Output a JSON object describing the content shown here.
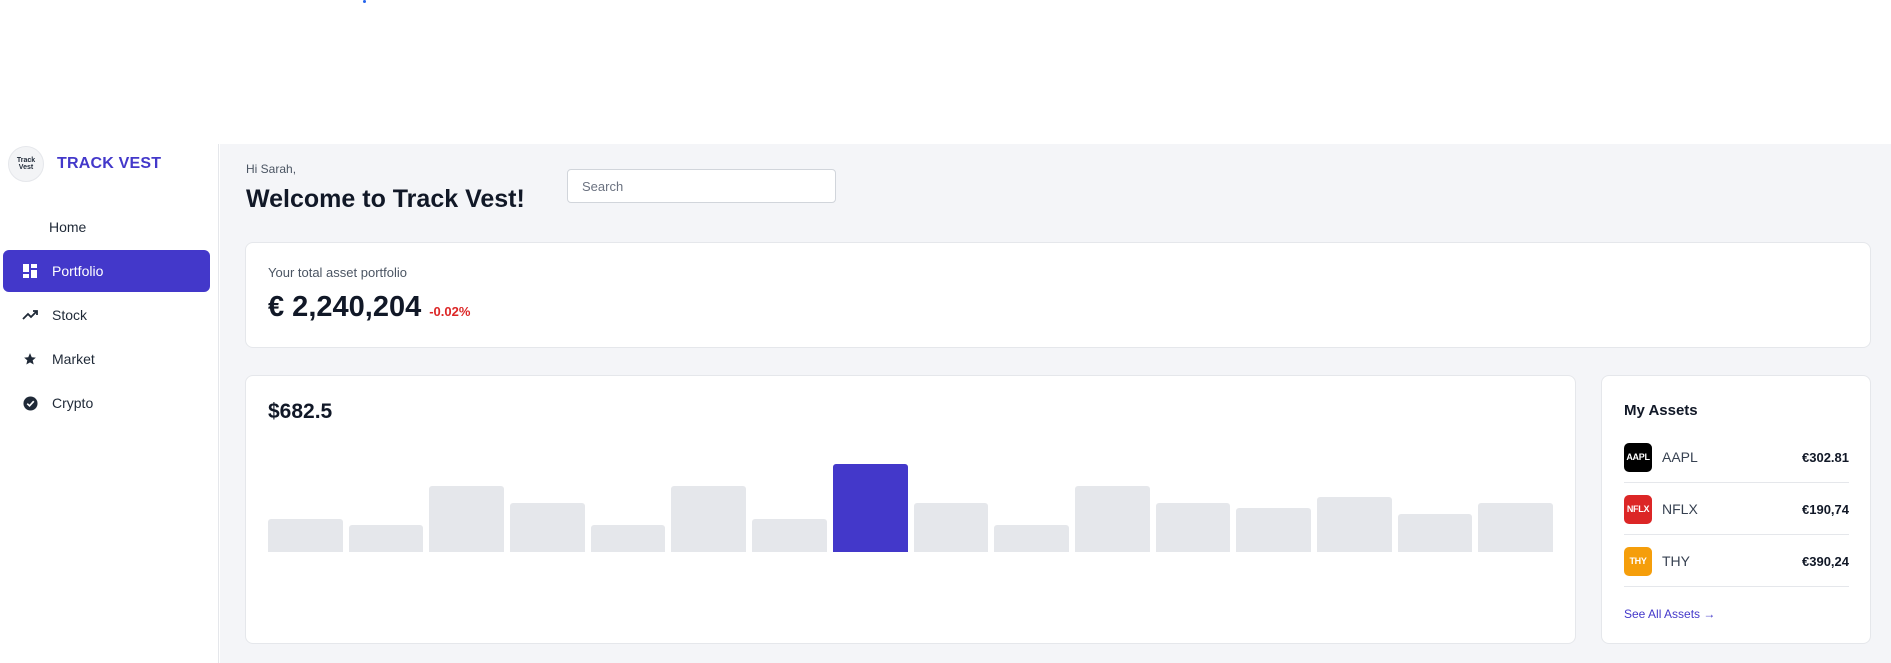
{
  "brand": {
    "logo_text": "Track Vest",
    "name": "TRACK VEST",
    "accent_color": "#4338ca"
  },
  "sidebar": {
    "items": [
      {
        "label": "Home",
        "icon": "none",
        "active": false
      },
      {
        "label": "Portfolio",
        "icon": "dashboard-icon",
        "active": true
      },
      {
        "label": "Stock",
        "icon": "trending-up-icon",
        "active": false
      },
      {
        "label": "Market",
        "icon": "star-icon",
        "active": false
      },
      {
        "label": "Crypto",
        "icon": "check-circle-icon",
        "active": false
      }
    ]
  },
  "header": {
    "greeting": "Hi Sarah,",
    "welcome": "Welcome to Track Vest!",
    "search_placeholder": "Search"
  },
  "total": {
    "label": "Your total asset portfolio",
    "amount": "€ 2,240,204",
    "change": "-0.02%",
    "change_color": "#dc2626"
  },
  "chart_data": {
    "type": "bar",
    "title": "$682.5",
    "values": [
      30,
      25,
      60,
      45,
      25,
      60,
      30,
      80,
      45,
      25,
      60,
      45,
      40,
      50,
      35,
      45
    ],
    "highlight_index": 7,
    "ylim": [
      0,
      80
    ]
  },
  "assets": {
    "title": "My Assets",
    "items": [
      {
        "ticker": "AAPL",
        "logo_text": "AAPL",
        "price": "€302.81",
        "logo_color": "#000000"
      },
      {
        "ticker": "NFLX",
        "logo_text": "NFLX",
        "price": "€190,74",
        "logo_color": "#dc2626"
      },
      {
        "ticker": "THY",
        "logo_text": "THY",
        "price": "€390,24",
        "logo_color": "#f59e0b"
      }
    ],
    "see_all": "See All Assets →"
  }
}
